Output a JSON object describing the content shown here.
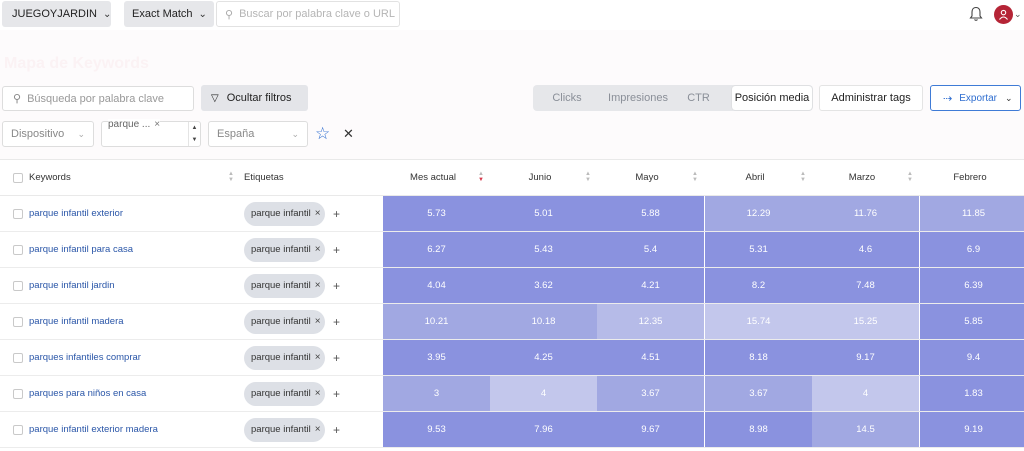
{
  "topbar": {
    "site_selector": "JUEGOYJARDIN",
    "match_selector": "Exact Match",
    "search_placeholder": "Buscar por palabra clave o URL"
  },
  "page": {
    "title": "Mapa de Keywords"
  },
  "filters": {
    "keyword_search_placeholder": "Búsqueda por palabra clave",
    "hide_filters_label": "Ocultar filtros",
    "metric_tabs": [
      "Clicks",
      "Impresiones",
      "CTR",
      "Posición media"
    ],
    "active_metric": "Posición media",
    "manage_tags_label": "Administrar tags",
    "export_label": "Exportar",
    "device_placeholder": "Dispositivo",
    "tag_filter_value": "parque ...",
    "country_value": "España"
  },
  "table": {
    "columns": {
      "keywords": "Keywords",
      "tags": "Etiquetas",
      "months": [
        "Mes actual",
        "Junio",
        "Mayo",
        "Abril",
        "Marzo",
        "Febrero"
      ]
    },
    "rows": [
      {
        "keyword": "parque infantil exterior",
        "tag": "parque infantil",
        "values": [
          "5.73",
          "5.01",
          "5.88",
          "12.29",
          "11.76",
          "11.85"
        ]
      },
      {
        "keyword": "parque infantil para casa",
        "tag": "parque infantil",
        "values": [
          "6.27",
          "5.43",
          "5.4",
          "5.31",
          "4.6",
          "6.9"
        ]
      },
      {
        "keyword": "parque infantil jardin",
        "tag": "parque infantil",
        "values": [
          "4.04",
          "3.62",
          "4.21",
          "8.2",
          "7.48",
          "6.39"
        ]
      },
      {
        "keyword": "parque infantil madera",
        "tag": "parque infantil",
        "values": [
          "10.21",
          "10.18",
          "12.35",
          "15.74",
          "15.25",
          "5.85"
        ]
      },
      {
        "keyword": "parques infantiles comprar",
        "tag": "parque infantil",
        "values": [
          "3.95",
          "4.25",
          "4.51",
          "8.18",
          "9.17",
          "9.4"
        ]
      },
      {
        "keyword": "parques para niños en casa",
        "tag": "parque infantil",
        "values": [
          "3",
          "4",
          "3.67",
          "3.67",
          "4",
          "1.83"
        ]
      },
      {
        "keyword": "parque infantil exterior madera",
        "tag": "parque infantil",
        "values": [
          "9.53",
          "7.96",
          "9.67",
          "8.98",
          "14.5",
          "9.19"
        ]
      }
    ],
    "heat_colors": [
      [
        "#8a92df",
        "#8a92df",
        "#8a92df",
        "#a1a8e2",
        "#a1a8e2",
        "#a1a8e2"
      ],
      [
        "#8a92df",
        "#8a92df",
        "#8a92df",
        "#8a92df",
        "#8a92df",
        "#8a92df"
      ],
      [
        "#8a92df",
        "#8a92df",
        "#8a92df",
        "#8a92df",
        "#8a92df",
        "#8a92df"
      ],
      [
        "#a1a8e2",
        "#a1a8e2",
        "#b6bbe8",
        "#c3c7ec",
        "#c3c7ec",
        "#8a92df"
      ],
      [
        "#8a92df",
        "#8a92df",
        "#8a92df",
        "#8a92df",
        "#8a92df",
        "#8a92df"
      ],
      [
        "#a1a8e2",
        "#c3c7ec",
        "#a1a8e2",
        "#a1a8e2",
        "#c3c7ec",
        "#8a92df"
      ],
      [
        "#8a92df",
        "#8a92df",
        "#8a92df",
        "#8a92df",
        "#a1a8e2",
        "#8a92df"
      ]
    ]
  },
  "colors": {
    "accent": "#2f6ed0",
    "avatar": "#b52436",
    "link": "#2a56a8",
    "sort_active": "#d63a4c"
  }
}
